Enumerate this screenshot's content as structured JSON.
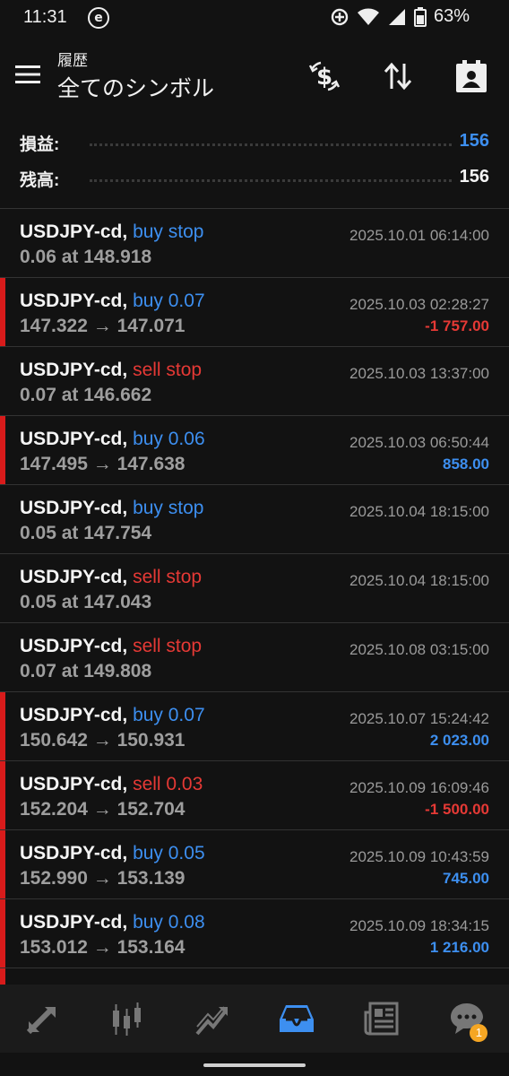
{
  "status_bar": {
    "time": "11:31",
    "app_badge": "e",
    "battery_text": "63%"
  },
  "app_bar": {
    "subtitle": "履歴",
    "title": "全てのシンボル"
  },
  "summary": {
    "profit_label": "損益:",
    "profit_value": "156",
    "balance_label": "残高:",
    "balance_value": "156"
  },
  "colors": {
    "buy": "#3d8ff0",
    "sell": "#e53935",
    "active_tab": "#3d8ff0",
    "marker": "#d81b1b",
    "badge": "#f5a623"
  },
  "rows": [
    {
      "symbol": "USDJPY-cd,",
      "action": "buy stop",
      "side": "buy",
      "detail": "0.06 at 148.918",
      "time": "2025.10.01 06:14:00",
      "profit": "",
      "marker": false
    },
    {
      "symbol": "USDJPY-cd,",
      "action": "buy 0.07",
      "side": "buy",
      "detail": "147.322 → 147.071",
      "time": "2025.10.03 02:28:27",
      "profit": "-1 757.00",
      "marker": true
    },
    {
      "symbol": "USDJPY-cd,",
      "action": "sell stop",
      "side": "sell",
      "detail": "0.07 at 146.662",
      "time": "2025.10.03 13:37:00",
      "profit": "",
      "marker": false
    },
    {
      "symbol": "USDJPY-cd,",
      "action": "buy 0.06",
      "side": "buy",
      "detail": "147.495 → 147.638",
      "time": "2025.10.03 06:50:44",
      "profit": "858.00",
      "marker": true
    },
    {
      "symbol": "USDJPY-cd,",
      "action": "buy stop",
      "side": "buy",
      "detail": "0.05 at 147.754",
      "time": "2025.10.04 18:15:00",
      "profit": "",
      "marker": false
    },
    {
      "symbol": "USDJPY-cd,",
      "action": "sell stop",
      "side": "sell",
      "detail": "0.05 at 147.043",
      "time": "2025.10.04 18:15:00",
      "profit": "",
      "marker": false
    },
    {
      "symbol": "USDJPY-cd,",
      "action": "sell stop",
      "side": "sell",
      "detail": "0.07 at 149.808",
      "time": "2025.10.08 03:15:00",
      "profit": "",
      "marker": false
    },
    {
      "symbol": "USDJPY-cd,",
      "action": "buy 0.07",
      "side": "buy",
      "detail": "150.642 → 150.931",
      "time": "2025.10.07 15:24:42",
      "profit": "2 023.00",
      "marker": true
    },
    {
      "symbol": "USDJPY-cd,",
      "action": "sell 0.03",
      "side": "sell",
      "detail": "152.204 → 152.704",
      "time": "2025.10.09 16:09:46",
      "profit": "-1 500.00",
      "marker": true
    },
    {
      "symbol": "USDJPY-cd,",
      "action": "buy 0.05",
      "side": "buy",
      "detail": "152.990 → 153.139",
      "time": "2025.10.09 10:43:59",
      "profit": "745.00",
      "marker": true
    },
    {
      "symbol": "USDJPY-cd,",
      "action": "buy 0.08",
      "side": "buy",
      "detail": "153.012 → 153.164",
      "time": "2025.10.09 18:34:15",
      "profit": "1 216.00",
      "marker": true
    },
    {
      "symbol": "",
      "action": "",
      "side": "buy",
      "detail": "",
      "time": "",
      "profit": "",
      "marker": true
    }
  ],
  "bottom_nav": [
    {
      "icon": "quotes-icon",
      "active": false
    },
    {
      "icon": "chart-icon",
      "active": false
    },
    {
      "icon": "trade-icon",
      "active": false
    },
    {
      "icon": "history-icon",
      "active": true
    },
    {
      "icon": "news-icon",
      "active": false
    },
    {
      "icon": "chat-icon",
      "active": false,
      "badge": "1"
    }
  ]
}
